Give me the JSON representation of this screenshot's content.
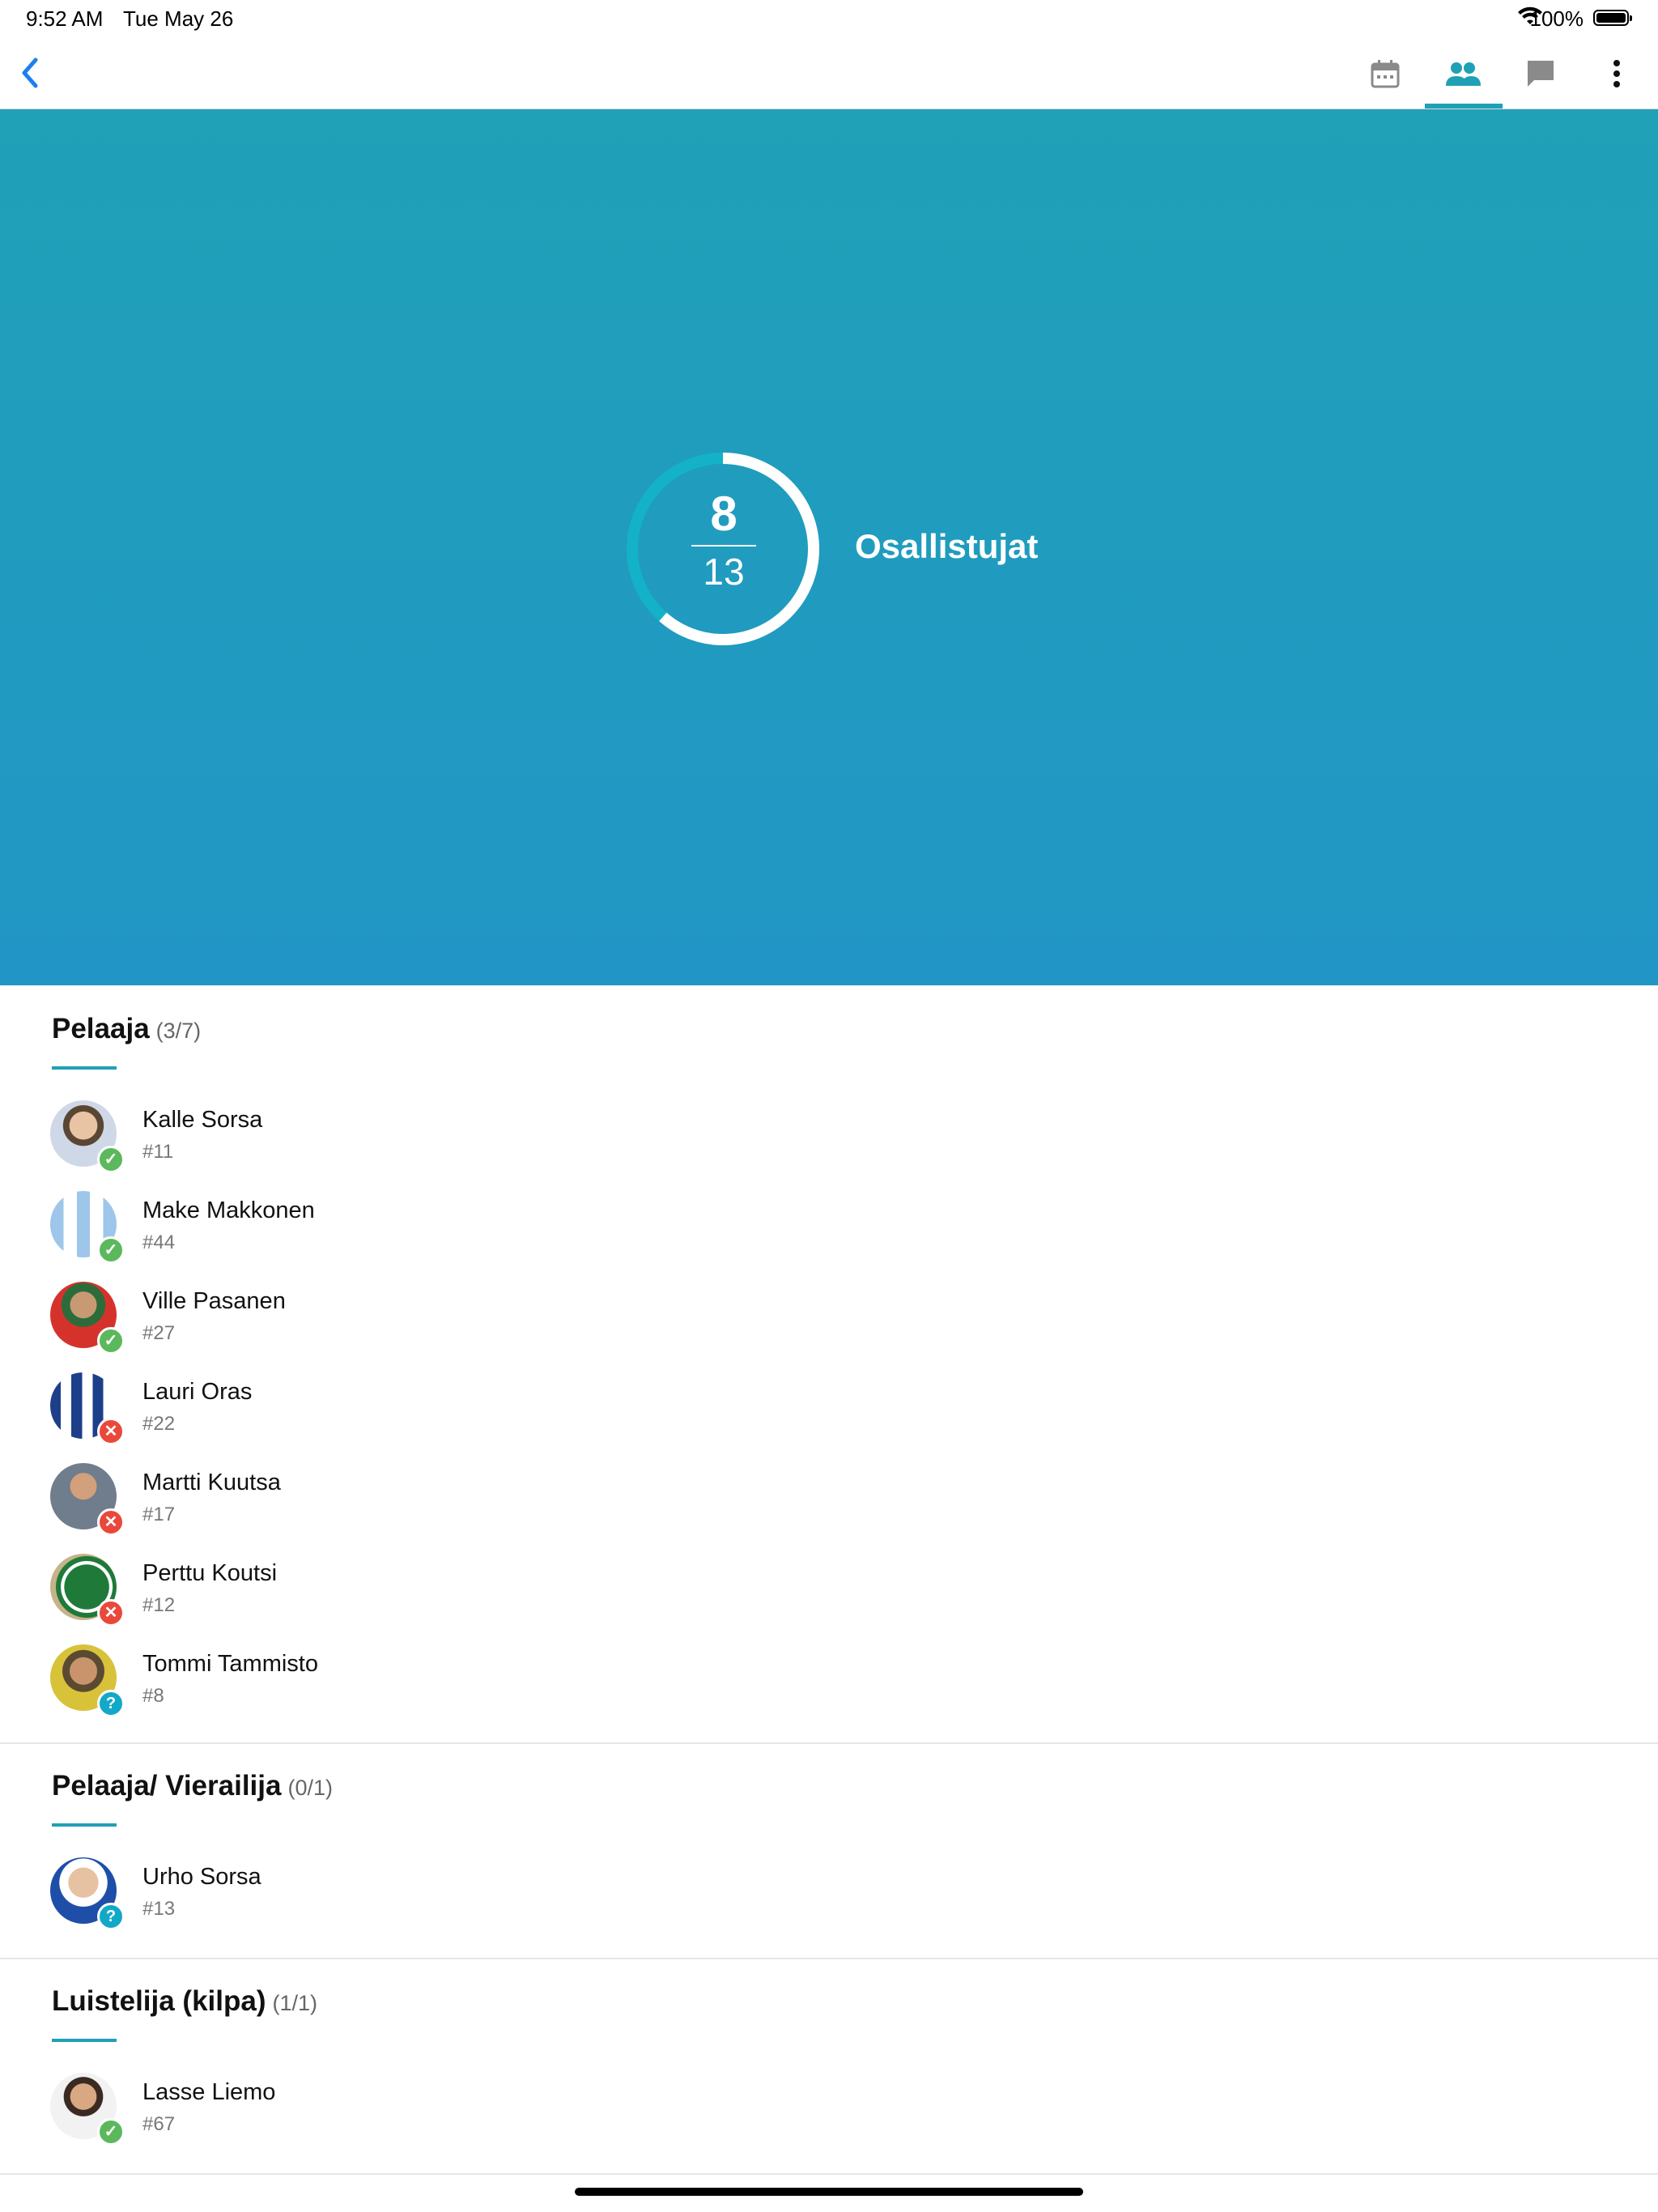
{
  "status_bar": {
    "time": "9:52 AM",
    "date": "Tue May 26",
    "battery": "100%"
  },
  "toolbar": {
    "back_icon": "chevron-left-icon",
    "icons": [
      "calendar-icon",
      "people-icon",
      "chat-icon",
      "more-vertical-icon"
    ],
    "accent": "#1fa0b5"
  },
  "summary": {
    "attending": "8",
    "total": "13",
    "label": "Osallistujat",
    "fraction": 0.615
  },
  "sections": [
    {
      "title": "Pelaaja",
      "count": "(3/7)",
      "members": [
        {
          "name": "Kalle Sorsa",
          "number": "#11",
          "status": "yes"
        },
        {
          "name": "Make Makkonen",
          "number": "#44",
          "status": "yes"
        },
        {
          "name": "Ville Pasanen",
          "number": "#27",
          "status": "yes"
        },
        {
          "name": "Lauri Oras",
          "number": "#22",
          "status": "no"
        },
        {
          "name": "Martti Kuutsa",
          "number": "#17",
          "status": "no"
        },
        {
          "name": "Perttu Koutsi",
          "number": "#12",
          "status": "no"
        },
        {
          "name": "Tommi Tammisto",
          "number": "#8",
          "status": "maybe"
        }
      ]
    },
    {
      "title": "Pelaaja/ Vierailija",
      "count": "(0/1)",
      "members": [
        {
          "name": "Urho Sorsa",
          "number": "#13",
          "status": "maybe"
        }
      ]
    },
    {
      "title": "Luistelija (kilpa)",
      "count": "(1/1)",
      "members": [
        {
          "name": "Lasse Liemo",
          "number": "#67",
          "status": "yes"
        }
      ]
    }
  ],
  "status_colors": {
    "yes": "#5cb85c",
    "no": "#e9483b",
    "maybe": "#13a8c8",
    "hero": "#20a1b7"
  }
}
